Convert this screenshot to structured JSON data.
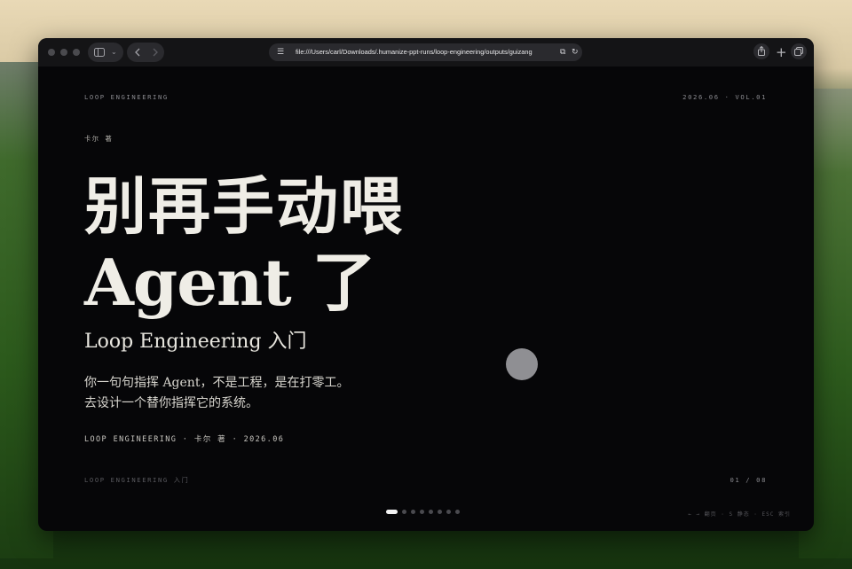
{
  "browser": {
    "url": "file:///Users/carl/Downloads/.humanize-ppt-runs/loop-engineering/outputs/guizang",
    "sidebar_icon": "sidebar-icon",
    "back_icon": "chevron-left-icon",
    "forward_icon": "chevron-right-icon"
  },
  "slide": {
    "header_left": "LOOP ENGINEERING",
    "header_right": "2026.06 · VOL.01",
    "author": "卡尔 著",
    "hero_line1": "别再手动喂",
    "hero_line2": "Agent 了",
    "subtitle": "Loop Engineering 入门",
    "body_line1": "你一句句指挥 Agent，不是工程，是在打零工。",
    "body_line2": "去设计一个替你指挥它的系统。",
    "meta": "LOOP ENGINEERING · 卡尔 著 · 2026.06",
    "footer_left": "LOOP ENGINEERING 入门",
    "footer_right": "01 / 08",
    "nav_hint": "← → 翻页 · S 静态 · ESC 索引",
    "page_count": 8,
    "current_page": 1
  },
  "colors": {
    "background": "#060608",
    "text": "#efede6",
    "muted": "#8a8a8f"
  }
}
